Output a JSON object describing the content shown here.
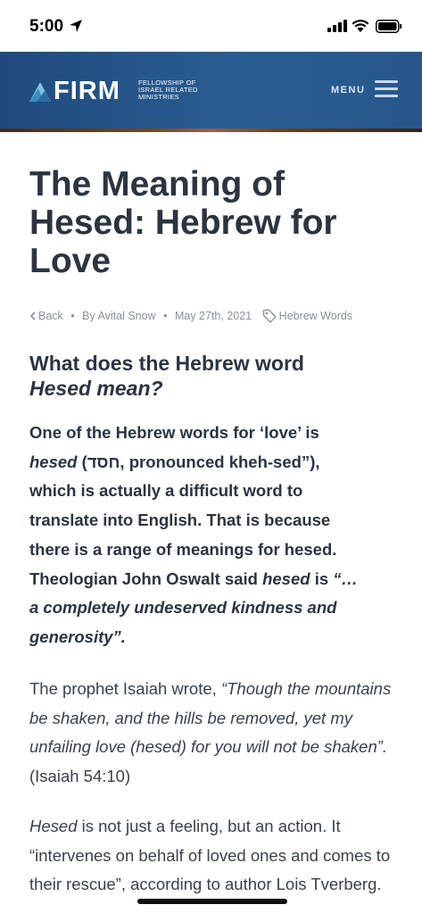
{
  "status_bar": {
    "time": "5:00"
  },
  "header": {
    "logo_word": "FIRM",
    "logo_sub_line1": "Fellowship of",
    "logo_sub_line2": "Israel Related",
    "logo_sub_line3": "Ministries",
    "menu_label": "MENU"
  },
  "article": {
    "title_line1": "The Meaning of",
    "title_line2": "Hesed: Hebrew for",
    "title_line3": "Love",
    "meta": {
      "back": "Back",
      "author": "By Avital Snow",
      "date": "May 27th, 2021",
      "category": "Hebrew Words"
    },
    "heading_plain": "What does the Hebrew word ",
    "heading_italic": "Hesed mean?",
    "lead": {
      "l1": "One of the Hebrew words for ‘love’ is",
      "l2_em": "hesed",
      "l2_rest": " (חסד, pronounced kheh-sed”),",
      "l3": "which is actually a difficult word to",
      "l4": "translate into English. That is because",
      "l5": "there is a range of meanings for hesed.",
      "l6_a": "Theologian John Oswalt said ",
      "l6_em": "hesed",
      "l6_b": " is ",
      "l6_quote": "“…",
      "l7": "a completely undeserved kindness and",
      "l8": "generosity”."
    },
    "p1": {
      "a": "The prophet Isaiah wrote, ",
      "quote": "“Though the mountains be shaken, and the hills be removed, yet my unfailing love (hesed) for you will not be shaken”.",
      "ref": " (Isaiah 54:10)"
    },
    "p2": {
      "em": "Hesed",
      "rest": " is not just a feeling, but an action. It “intervenes on behalf of loved ones and comes to their rescue”, according to author Lois Tverberg."
    }
  },
  "colors": {
    "header_bg": "#2a5d93",
    "text": "#2c3440",
    "muted": "#8a9098"
  }
}
